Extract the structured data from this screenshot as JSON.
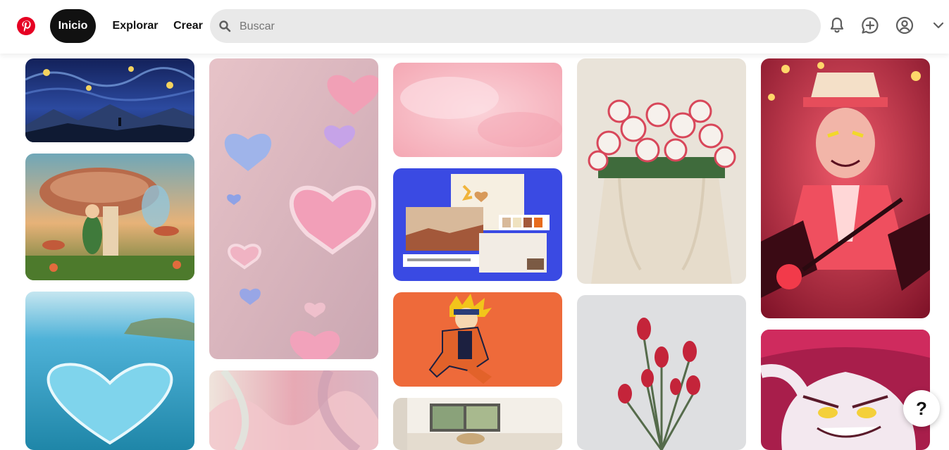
{
  "header": {
    "nav": {
      "home_label": "Inicio",
      "explore_label": "Explorar",
      "create_label": "Crear"
    },
    "search": {
      "placeholder": "Buscar"
    },
    "icons": [
      "pinterest-logo-icon",
      "search-icon",
      "bell-icon",
      "message-icon",
      "profile-icon",
      "chevron-down-icon"
    ]
  },
  "pins": [
    {
      "column": 1,
      "subject": "starry night landscape"
    },
    {
      "column": 1,
      "subject": "fairy with mushrooms"
    },
    {
      "column": 1,
      "subject": "water heart"
    },
    {
      "column": 2,
      "subject": "pink 3D hearts lovely"
    },
    {
      "column": 2,
      "subject": "pink fluid shapes"
    },
    {
      "column": 3,
      "subject": "pink watercolor"
    },
    {
      "column": 3,
      "subject": "presentation template mockup"
    },
    {
      "column": 3,
      "subject": "naruto orange"
    },
    {
      "column": 3,
      "subject": "interior room"
    },
    {
      "column": 4,
      "subject": "roses in tote bag"
    },
    {
      "column": 4,
      "subject": "red tulips"
    },
    {
      "column": 5,
      "subject": "red demon character"
    },
    {
      "column": 5,
      "subject": "pink grinning character"
    }
  ],
  "help_button": {
    "label": "?"
  },
  "colors": {
    "brand": "#e60023",
    "active_nav": "#111111",
    "search_bg": "#e9e9e9"
  }
}
